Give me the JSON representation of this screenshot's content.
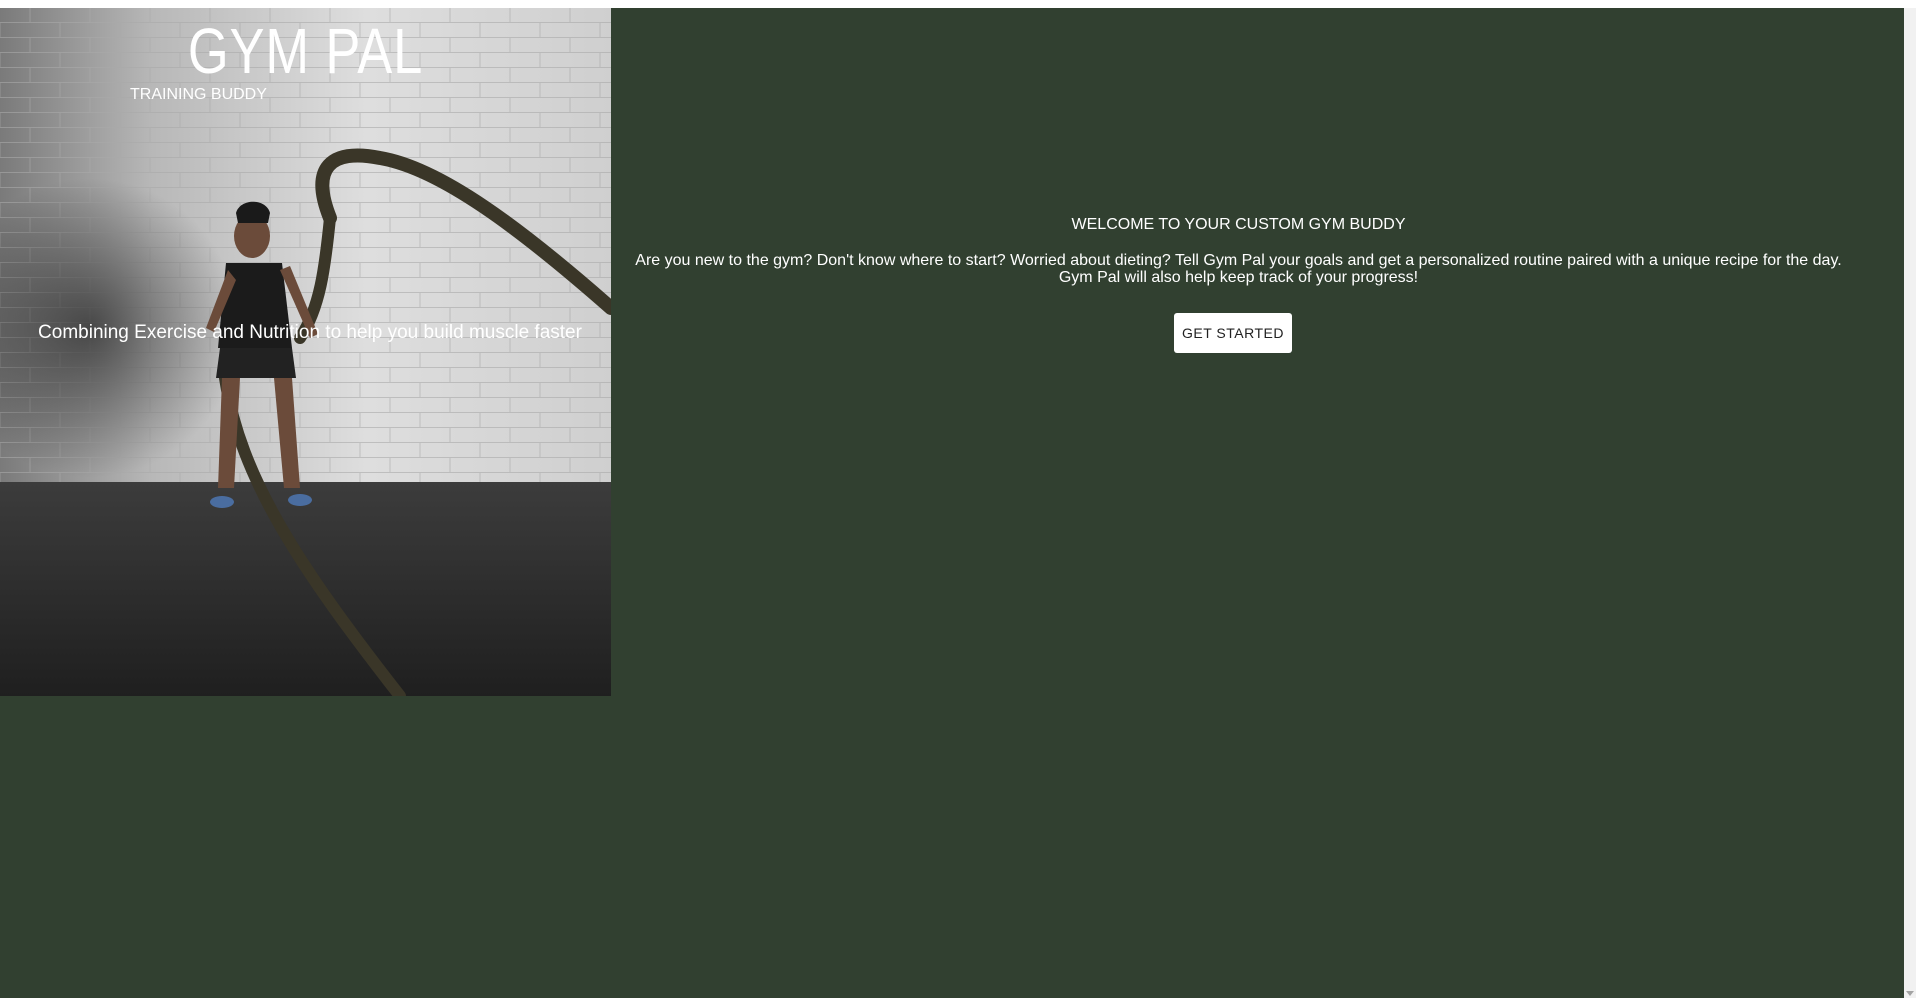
{
  "brand": {
    "title": "GYM PAL",
    "subtitle": "TRAINING BUDDY"
  },
  "hero": {
    "tagline": "Combining Exercise and Nutrition to help you build muscle faster"
  },
  "welcome": {
    "heading": "WELCOME TO YOUR CUSTOM GYM BUDDY",
    "line1": "Are you new to the gym? Don't know where to start? Worried about dieting? Tell Gym Pal your goals and get a personalized routine paired with a unique recipe for the day.",
    "line2": "Gym Pal will also help keep track of your progress!",
    "cta_label": "GET STARTED"
  },
  "colors": {
    "page_background": "#314030",
    "text": "#ffffff",
    "button_background": "#ffffff",
    "button_text": "#222222"
  }
}
